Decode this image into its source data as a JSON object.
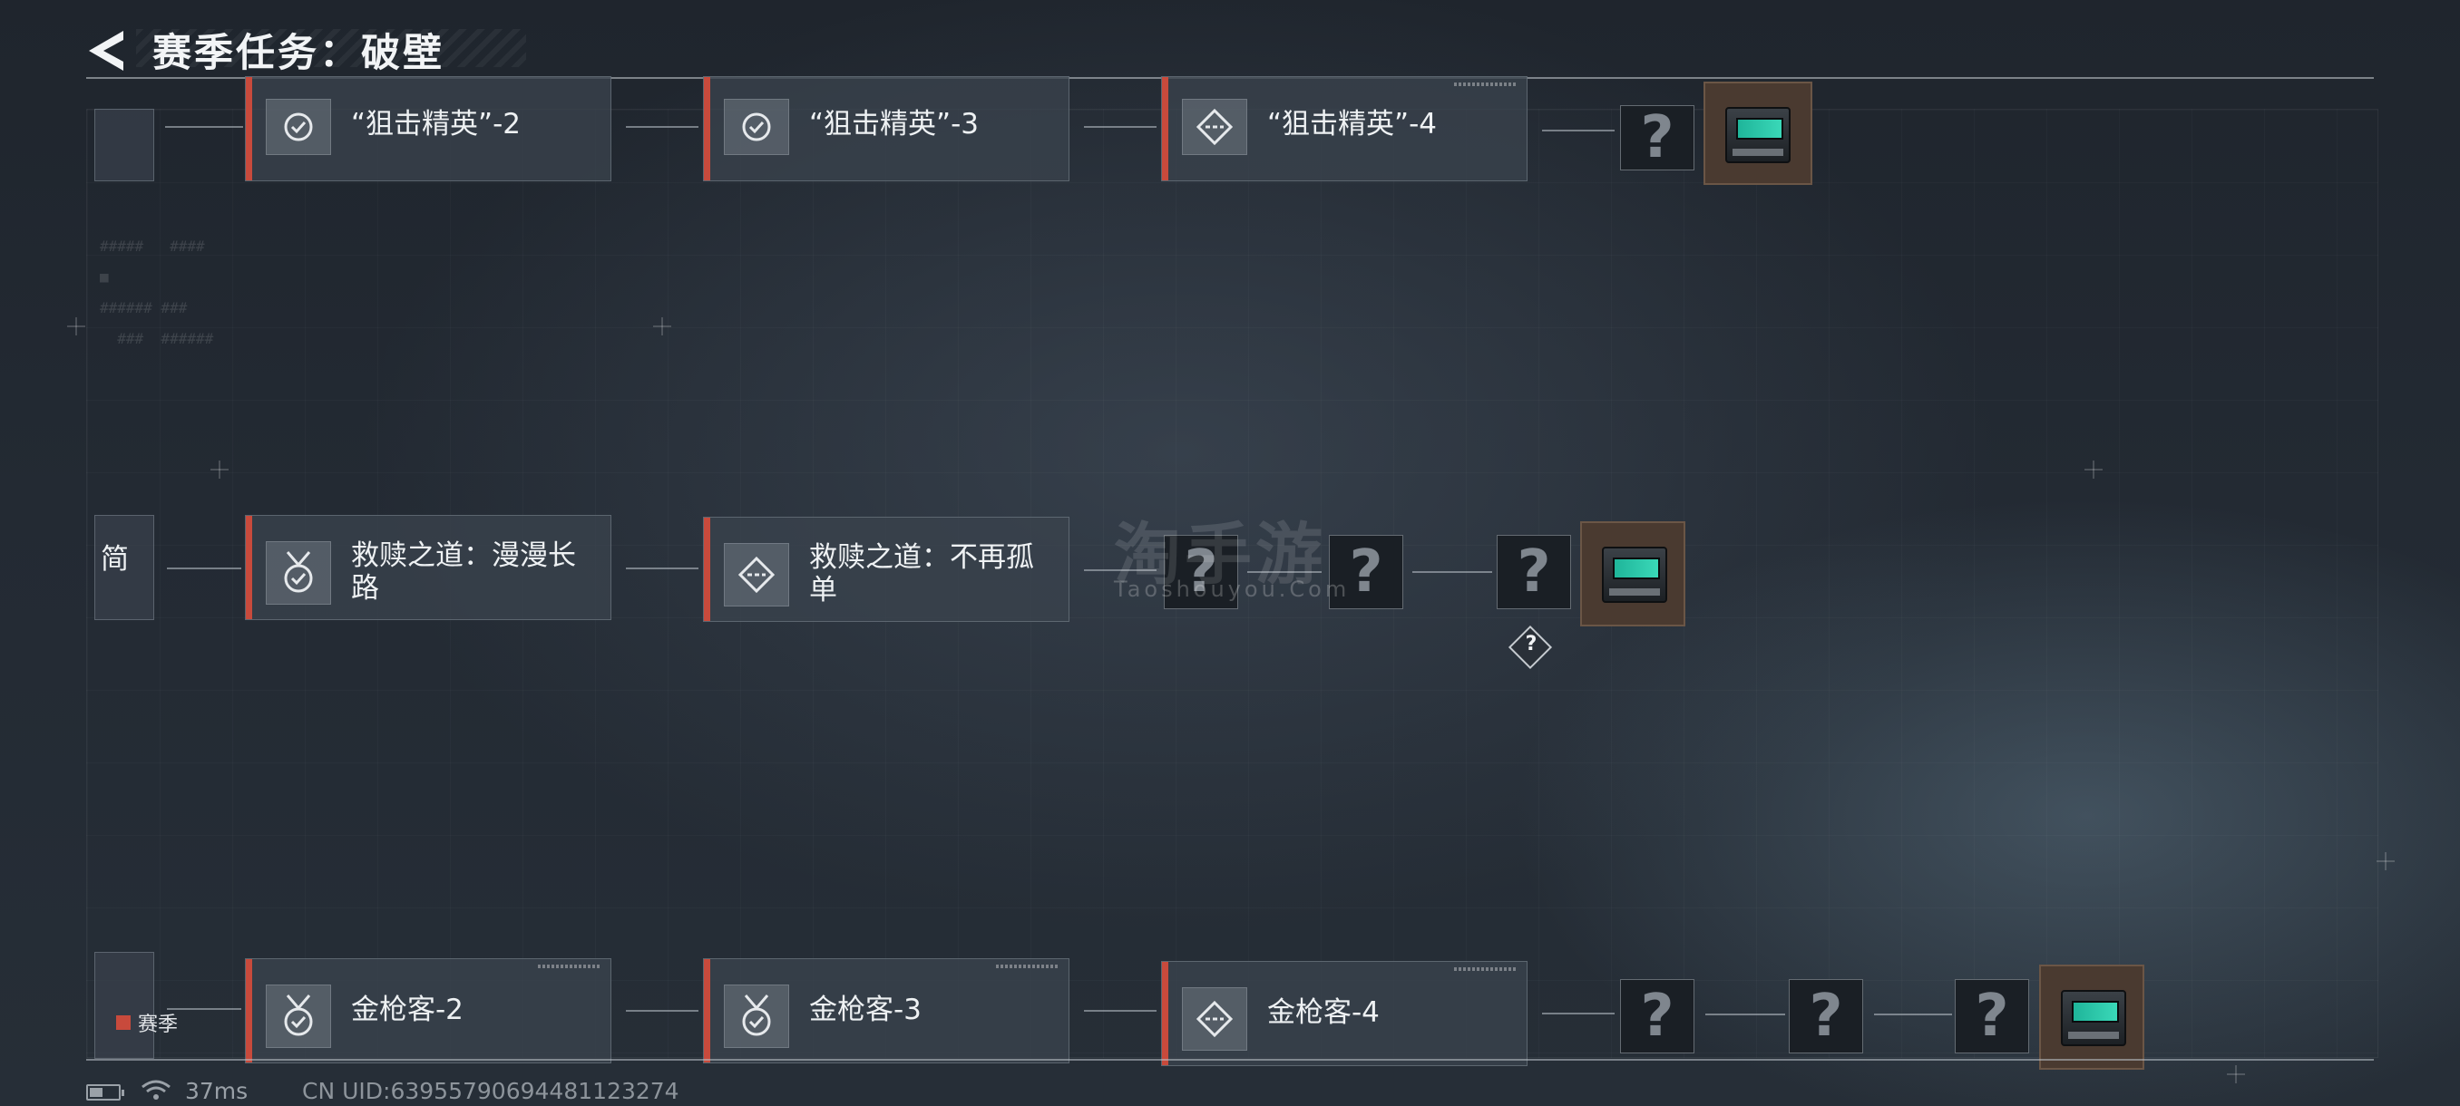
{
  "header": {
    "title": "赛季任务：破壁"
  },
  "rows": {
    "top": {
      "stub_text": "",
      "nodes": [
        {
          "label": "“狙击精英”-2",
          "icon": "check-circle-icon"
        },
        {
          "label": "“狙击精英”-3",
          "icon": "check-circle-icon"
        },
        {
          "label": "“狙击精英”-4",
          "icon": "dashed-diamond-icon"
        }
      ],
      "locked": [
        "?"
      ]
    },
    "middle": {
      "stub_text": "简",
      "nodes": [
        {
          "label": "救赎之道：漫漫长路",
          "icon": "medal-check-icon"
        },
        {
          "label": "救赎之道：不再孤单",
          "icon": "dashed-diamond-icon"
        }
      ],
      "locked": [
        "?",
        "?",
        "?"
      ],
      "badge": "?"
    },
    "bottom": {
      "stub_text": "",
      "nodes": [
        {
          "label": "金枪客-2",
          "icon": "medal-check-icon"
        },
        {
          "label": "金枪客-3",
          "icon": "medal-check-icon"
        },
        {
          "label": "金枪客-4",
          "icon": "dashed-diamond-icon"
        }
      ],
      "locked": [
        "?",
        "?",
        "?"
      ]
    }
  },
  "legend": {
    "label": "赛季",
    "color": "#c84a3c"
  },
  "status": {
    "ping": "37ms",
    "uid": "CN UID:639557906944811​23274",
    "battery_level": 0.45
  },
  "watermark": {
    "main": "淘手游",
    "sub": "Taoshouyou.Com"
  }
}
